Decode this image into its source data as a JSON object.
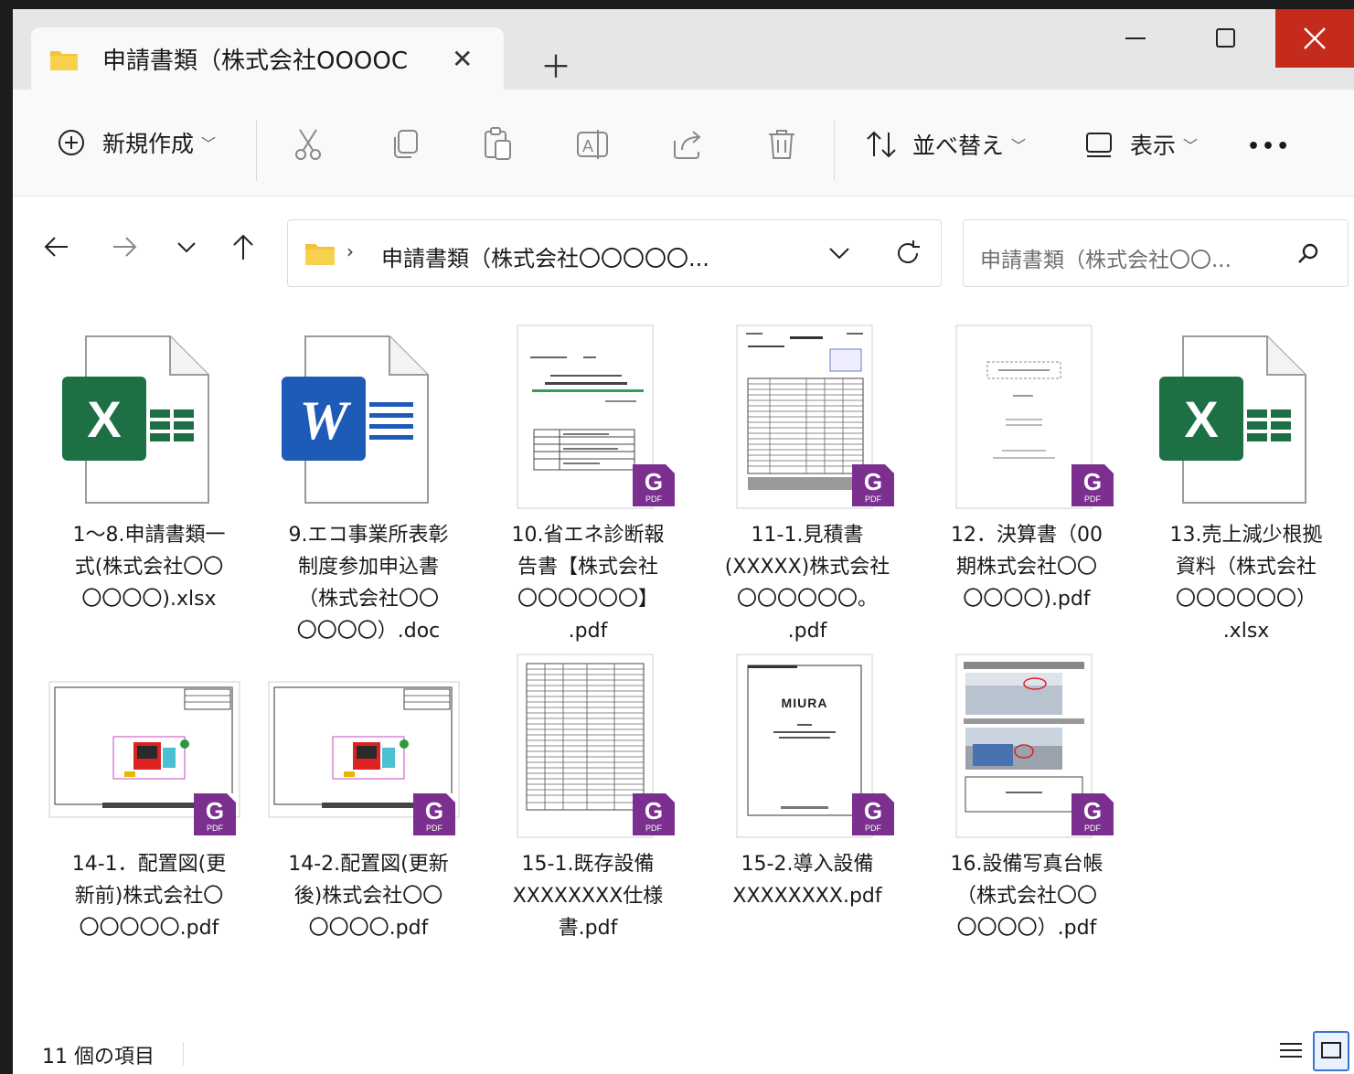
{
  "tab": {
    "title": "申請書類（株式会社OOOOC"
  },
  "toolbar": {
    "new_label": "新規作成",
    "sort_label": "並べ替え",
    "view_label": "表示",
    "more_label": "•••"
  },
  "address": {
    "breadcrumb": "申請書類（株式会社〇〇〇〇〇..."
  },
  "search": {
    "placeholder": "申請書類（株式会社〇〇..."
  },
  "files": [
    {
      "name": "1～8.申請書類一\n式(株式会社〇〇\n〇〇〇〇).xlsx",
      "type": "excel"
    },
    {
      "name": "9.エコ事業所表彰\n制度参加申込書\n（株式会社〇〇\n〇〇〇〇）.doc",
      "type": "word"
    },
    {
      "name": "10.省エネ診断報\n告書【株式会社\n〇〇〇〇〇〇】\n.pdf",
      "type": "pdf"
    },
    {
      "name": "11-1.見積書\n(XXXXX)株式会社\n〇〇〇〇〇〇。\n.pdf",
      "type": "pdf"
    },
    {
      "name": "12．決算書（00\n期株式会社〇〇\n〇〇〇〇).pdf",
      "type": "pdf"
    },
    {
      "name": "13.売上減少根拠\n資料（株式会社\n〇〇〇〇〇〇）\n.xlsx",
      "type": "excel"
    },
    {
      "name": "14-1．配置図(更\n新前)株式会社〇\n〇〇〇〇〇.pdf",
      "type": "pdf"
    },
    {
      "name": "14-2.配置図(更新\n後)株式会社〇〇\n〇〇〇〇.pdf",
      "type": "pdf"
    },
    {
      "name": "15-1.既存設備\nXXXXXXXX仕様\n書.pdf",
      "type": "pdf"
    },
    {
      "name": "15-2.導入設備\nXXXXXXXX.pdf",
      "type": "pdf"
    },
    {
      "name": "16.設備写真台帳\n（株式会社〇〇\n〇〇〇〇）.pdf",
      "type": "pdf"
    }
  ],
  "thumb_text": {
    "miura_logo": "MIURA",
    "pdf_badge": "PDF",
    "excel_letter": "X",
    "word_letter": "W"
  },
  "status": {
    "count": "11 個の項目"
  },
  "colors": {
    "close": "#c42b1c",
    "pdf_badge": "#7b2f8e",
    "excel": "#1d7044",
    "word": "#1e5bb8",
    "folder": "#f3c13a"
  }
}
